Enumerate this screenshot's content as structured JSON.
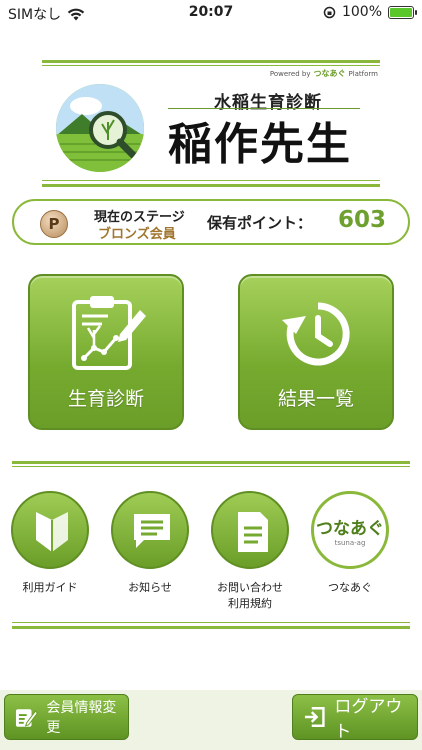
{
  "status_bar": {
    "carrier": "SIMなし",
    "time": "20:07",
    "battery": "100%",
    "battery_level": 1.0
  },
  "header": {
    "powered_by": "Powered by",
    "brand": "つなあぐ",
    "platform": "Platform",
    "subtitle": "水稲生育診断",
    "title": "稲作先生"
  },
  "stage_panel": {
    "coin_letter": "P",
    "stage_label": "現在のステージ",
    "stage_value": "ブロンズ会員",
    "points_label": "保有ポイント：",
    "points_value": "603"
  },
  "main_buttons": {
    "diagnosis_label": "生育診断",
    "results_label": "結果一覧"
  },
  "menu": {
    "guide_label": "利用ガイド",
    "news_label": "お知らせ",
    "contact_label": "お問い合わせ",
    "terms_label": "利用規約",
    "tsunagu_label": "つなあぐ",
    "tsunagu_logo_text": "つなあぐ",
    "tsunagu_logo_sub": "tsuna-ag"
  },
  "bottom_bar": {
    "member_info_label": "会員情報変更",
    "logout_label": "ログアウト"
  },
  "colors": {
    "accent": "#8ab83a",
    "button_green": "#76aa2f",
    "points_green": "#6ea02f",
    "bronze": "#a0762e"
  }
}
